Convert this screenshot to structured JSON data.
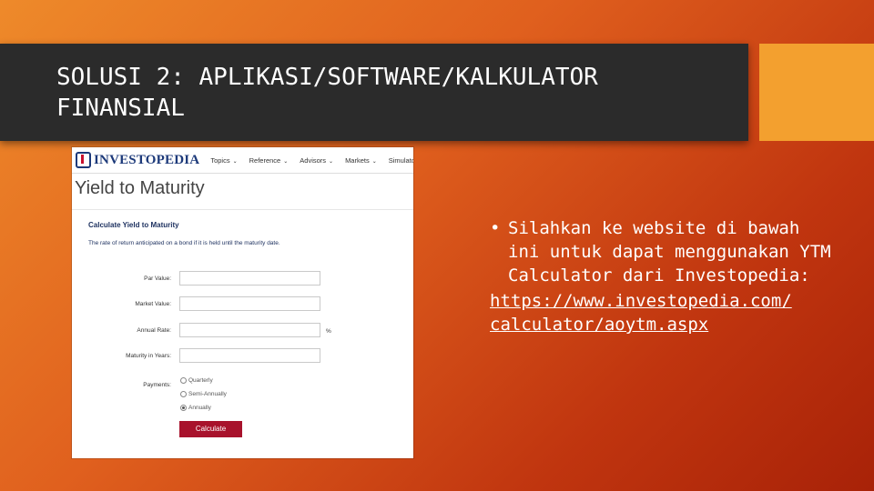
{
  "slide": {
    "title": "SOLUSI 2: APLIKASI/SOFTWARE/KALKULATOR FINANSIAL",
    "bullet_text": "Silahkan ke website di bawah ini untuk dapat menggunakan YTM Calculator dari Investopedia:",
    "link_line1": "https://www.investopedia.com/",
    "link_line2": "calculator/aoytm.aspx"
  },
  "screenshot": {
    "logo": "INVESTOPEDIA",
    "nav": [
      "Topics",
      "Reference",
      "Advisors",
      "Markets",
      "Simulator"
    ],
    "page_heading": "Yield to Maturity",
    "calc_title": "Calculate Yield to Maturity",
    "calc_desc": "The rate of return anticipated on a bond if it is held until the maturity date.",
    "fields": [
      {
        "label": "Par Value:",
        "value": "",
        "unit": ""
      },
      {
        "label": "Market Value:",
        "value": "",
        "unit": ""
      },
      {
        "label": "Annual Rate:",
        "value": "",
        "unit": "%"
      },
      {
        "label": "Maturity in Years:",
        "value": "",
        "unit": ""
      }
    ],
    "payments_label": "Payments:",
    "payment_options": [
      "Quarterly",
      "Semi-Annually",
      "Annually"
    ],
    "selected_payment": "Annually",
    "calculate_label": "Calculate"
  },
  "colors": {
    "title_bar": "#2b2b2b",
    "accent": "#f3a02f",
    "calculate_button": "#a8122c",
    "investopedia_blue": "#1d3a7a"
  }
}
